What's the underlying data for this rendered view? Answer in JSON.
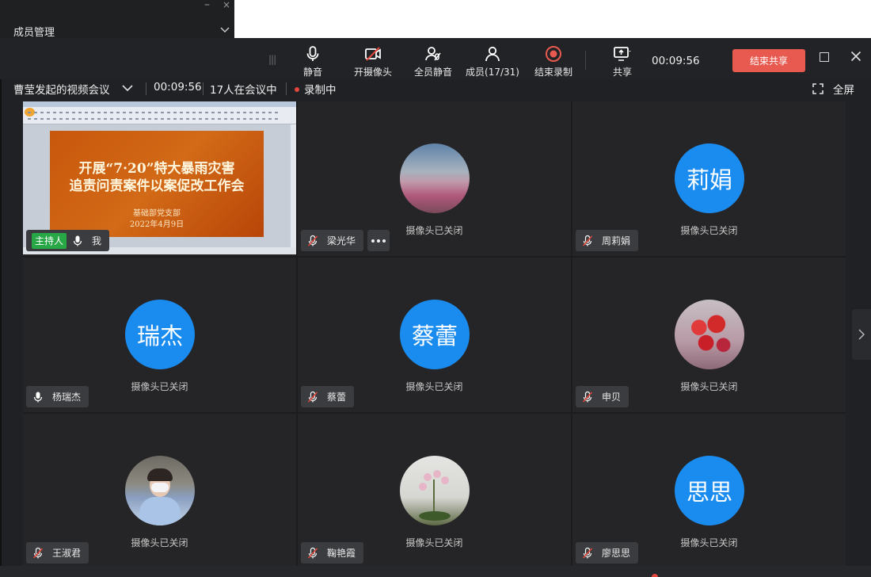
{
  "member_panel": {
    "title": "成员管理",
    "minimize": "–",
    "close": "×"
  },
  "toolbar": {
    "items": [
      {
        "label": "静音",
        "icon": "microphone-icon"
      },
      {
        "label": "开摄像头",
        "icon": "camera-off-icon"
      },
      {
        "label": "全员静音",
        "icon": "mute-all-icon"
      },
      {
        "label": "成员(17/31)",
        "icon": "members-icon"
      },
      {
        "label": "结束录制",
        "icon": "stop-record-icon"
      },
      {
        "label": "共享",
        "icon": "share-screen-icon"
      }
    ],
    "timer": "00:09:56",
    "end_share": "结束共享"
  },
  "infobar": {
    "meeting_title": "曹莹发起的视频会议",
    "duration": "00:09:56",
    "participants": "17人在会议中",
    "recording": "录制中",
    "fullscreen": "全屏"
  },
  "camera_off_text": "摄像头已关闭",
  "tiles": [
    {
      "name": "我",
      "host_label": "主持人",
      "shared_screen": true,
      "mic": "on"
    },
    {
      "name": "梁光华",
      "avatar": "photo",
      "mic": "muted"
    },
    {
      "name": "周莉娟",
      "avatar_text": "莉娟",
      "mic": "muted"
    },
    {
      "name": "杨瑞杰",
      "avatar_text": "瑞杰",
      "mic": "on"
    },
    {
      "name": "蔡蕾",
      "avatar_text": "蔡蕾",
      "mic": "muted"
    },
    {
      "name": "申贝",
      "avatar": "photo",
      "mic": "muted"
    },
    {
      "name": "王淑君",
      "avatar": "photo",
      "mic": "muted"
    },
    {
      "name": "鞠艳霞",
      "avatar": "photo",
      "mic": "muted"
    },
    {
      "name": "廖思思",
      "avatar_text": "思思",
      "mic": "muted"
    }
  ],
  "shared_slide": {
    "line1": "开展“7·20”特大暴雨灾害",
    "line2": "追责问责案件以案促改工作会",
    "org": "基础部党支部",
    "date": "2022年4月9日"
  },
  "colors": {
    "avatar_blue": "#1a8cf0",
    "end_share_red": "#e85a4f",
    "record_red": "#e3463a",
    "host_green": "#27a745"
  }
}
